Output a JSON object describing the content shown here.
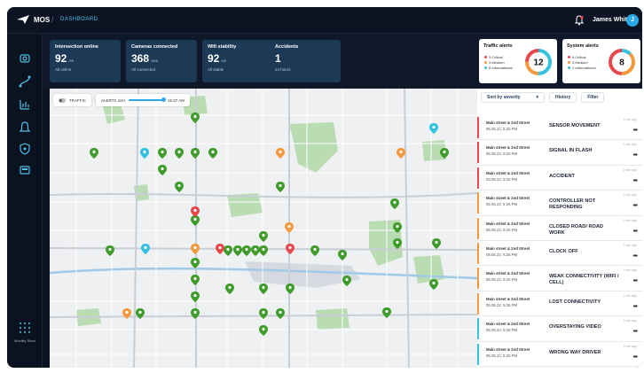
{
  "app": {
    "name": "MOS",
    "breadcrumb": "DASHBOARD"
  },
  "user": {
    "name": "James White",
    "initial": "J"
  },
  "sidebar": {
    "footer": "Mobility Stars"
  },
  "kpis": [
    {
      "title": "Intersection online",
      "value": "92",
      "unit": "/95",
      "sub": "All online"
    },
    {
      "title": "Cameras connected",
      "value": "368",
      "unit": "/368",
      "sub": "All connected"
    },
    {
      "title": "Wifi stability",
      "value": "92",
      "unit": "/95",
      "sub": "All stable"
    },
    {
      "title": "Accidents",
      "value": "1",
      "unit": "",
      "sub": "24 hours"
    }
  ],
  "traffic_alerts": {
    "title": "Traffic alerts",
    "count": "12",
    "legend": [
      "3 Critical",
      "3 Medium",
      "6 Informational"
    ]
  },
  "system_alerts": {
    "title": "System alerts",
    "count": "8",
    "legend": [
      "4 Critical",
      "3 Medium",
      "1 Informational"
    ]
  },
  "map": {
    "traffic_label": "TRAFFIC",
    "alerts_label": "ALERTS 24H",
    "alerts_time": "15:37 AM"
  },
  "filters": {
    "sort": "Sort by severity",
    "history": "History",
    "filter": "Filter"
  },
  "alerts": [
    {
      "loc": "Main street & 2nd Street",
      "dt": "05.05.22, 5:26 PM",
      "event": "SENSOR MOVEMENT",
      "severity": "critical",
      "ago": "2 min ago"
    },
    {
      "loc": "Main street & 2nd Street",
      "dt": "05.05.22, 5:26 PM",
      "event": "SIGNAL IN FLASH",
      "severity": "critical",
      "ago": "2 min ago"
    },
    {
      "loc": "Main street & 2nd Street",
      "dt": "03.05.22, 5:26 PM",
      "event": "ACCIDENT",
      "severity": "critical",
      "ago": "2 min ago"
    },
    {
      "loc": "Main street & 2nd Street",
      "dt": "05.05.22, 5:26 PM",
      "event": "CONTROLLER NOT RESPONDING",
      "severity": "medium",
      "ago": "2 min ago"
    },
    {
      "loc": "Main street & 2nd Street",
      "dt": "05.05.22, 5:26 PM",
      "event": "CLOSED ROAD/ ROAD WORK",
      "severity": "medium",
      "ago": "2 min ago"
    },
    {
      "loc": "Main street & 2nd Street",
      "dt": "05.05.22, 5:26 PM",
      "event": "CLOCK OFF",
      "severity": "medium",
      "ago": "2 min ago"
    },
    {
      "loc": "Main street & 2nd Street",
      "dt": "05.05.22, 5:26 PM",
      "event": "WEAK CONNECTIVITY (WIFI / CELL)",
      "severity": "medium",
      "ago": "2 min ago"
    },
    {
      "loc": "Main street & 2nd Street",
      "dt": "05.05.22, 5:26 PM",
      "event": "LOST CONNECTIVITY",
      "severity": "medium",
      "ago": "2 min ago"
    },
    {
      "loc": "Main street & 2nd Street",
      "dt": "05.05.22, 5:26 PM",
      "event": "OVERSTAYING VIDEO",
      "severity": "info",
      "ago": "2 min ago"
    },
    {
      "loc": "Main street & 2nd Street",
      "dt": "05.05.22, 5:26 PM",
      "event": "WRONG WAY DRIVER",
      "severity": "info",
      "ago": "2 min ago"
    }
  ],
  "colors": {
    "critical": "#e8474b",
    "medium": "#f29a3d",
    "info": "#33c1e0",
    "ok": "#3f9b2a",
    "accent": "#2aa8e8"
  }
}
